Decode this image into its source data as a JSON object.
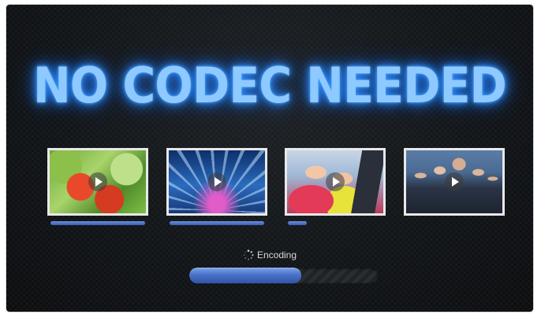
{
  "headline": "NO CODEC NEEDED",
  "colors": {
    "headline_glow": "#2f8fff",
    "progress_fill": "#4a72c8",
    "background": "#121518"
  },
  "thumbnails": [
    {
      "subject": "salad",
      "icon": "play-icon",
      "progress": 1.0
    },
    {
      "subject": "concert",
      "icon": "play-icon",
      "progress": 1.0
    },
    {
      "subject": "phones",
      "icon": "play-icon",
      "progress": 0.2
    },
    {
      "subject": "group",
      "icon": "play-icon",
      "progress": 0.0
    }
  ],
  "status": {
    "label": "Encoding",
    "icon": "spinner-icon",
    "progress": 0.59
  }
}
